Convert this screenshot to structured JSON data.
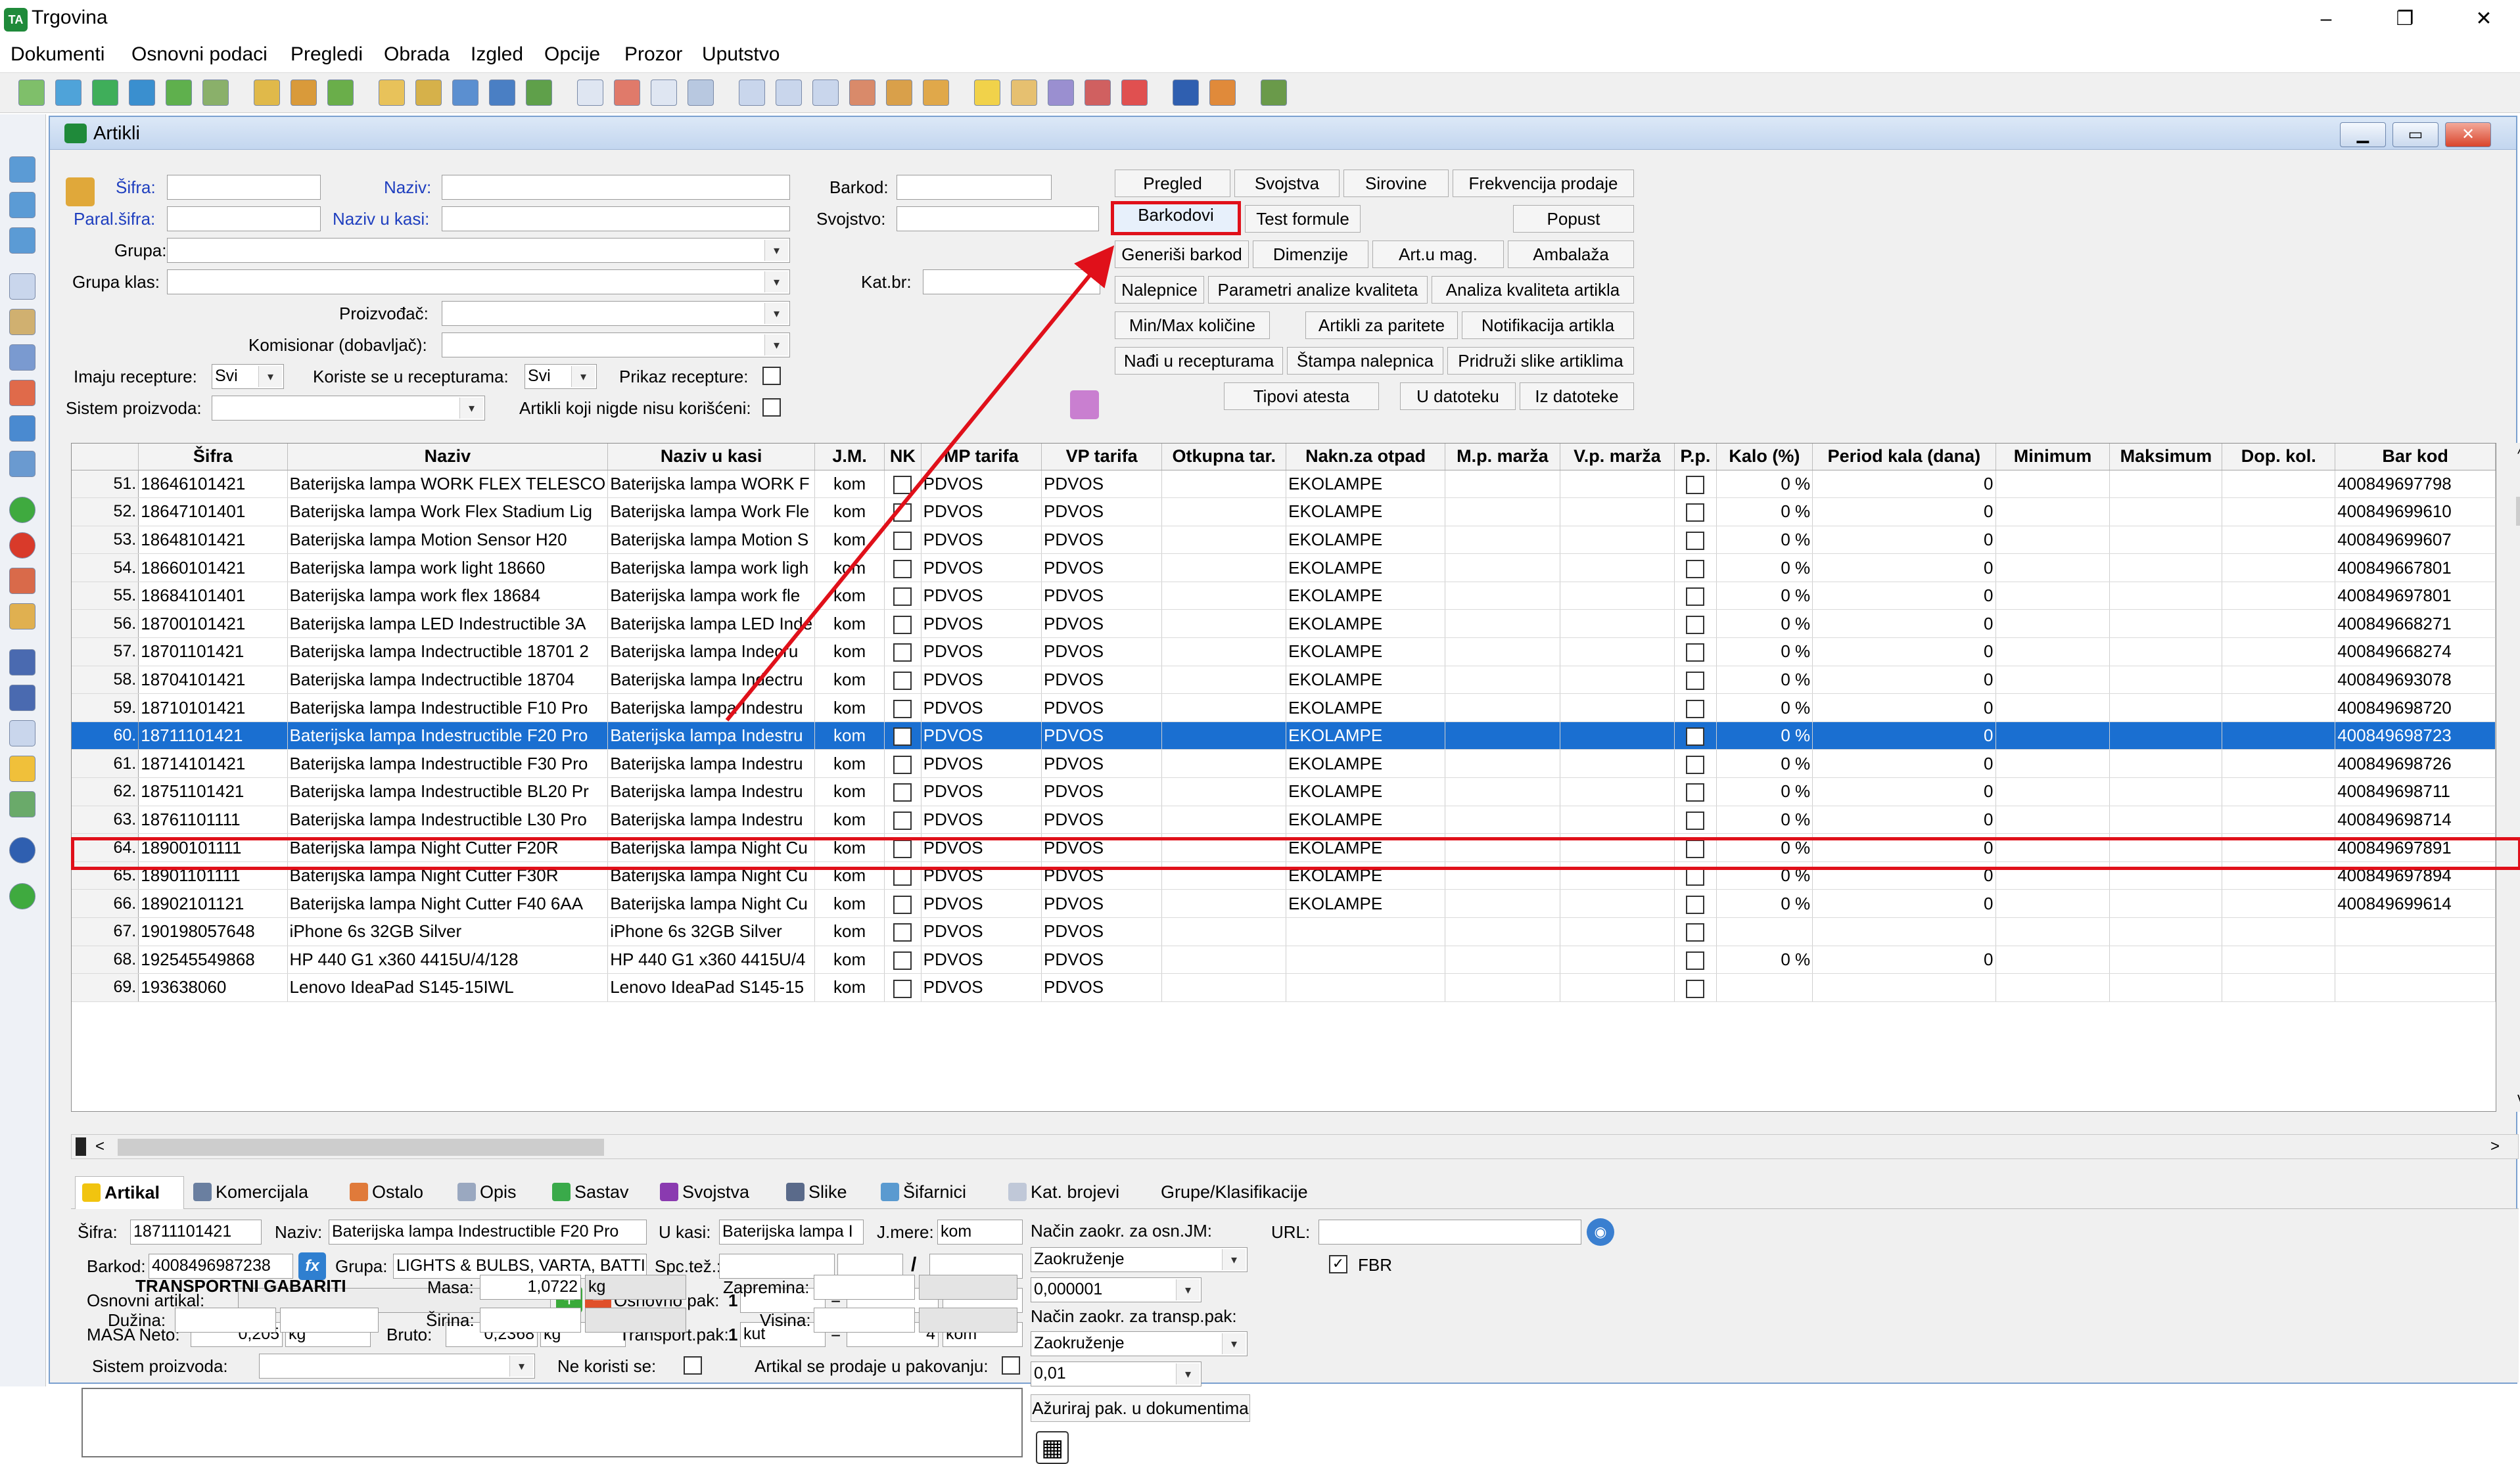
{
  "app": {
    "title": "Trgovina"
  },
  "menu": [
    "Dokumenti",
    "Osnovni podaci",
    "Pregledi",
    "Obrada",
    "Izgled",
    "Opcije",
    "Prozor",
    "Uputstvo"
  ],
  "window_controls": {
    "minimize": "–",
    "restore": "❐",
    "close": "✕"
  },
  "child": {
    "title": "Artikli",
    "minimize": "▁",
    "restore": "▭",
    "close": "✕"
  },
  "filters": {
    "sifra_label": "Šifra:",
    "naziv_label": "Naziv:",
    "paral_label": "Paral.šifra:",
    "naziv_kasa_label": "Naziv u kasi:",
    "grupa_label": "Grupa:",
    "grupa_klas_label": "Grupa klas:",
    "proizvodjac_label": "Proizvođač:",
    "komisionar_label": "Komisionar (dobavljač):",
    "imaju_label": "Imaju recepture:",
    "imaju_value": "Svi",
    "koriste_label": "Koriste se u recepturama:",
    "koriste_value": "Svi",
    "prikaz_label": "Prikaz recepture:",
    "sistem_label": "Sistem proizvoda:",
    "nigde_label": "Artikli koji nigde nisu korišćeni:",
    "barkod_label": "Barkod:",
    "svojstvo_label": "Svojstvo:",
    "katbr_label": "Kat.br:"
  },
  "buttons": {
    "pregled": "Pregled",
    "svojstva": "Svojstva",
    "sirovine": "Sirovine",
    "frekvencija": "Frekvencija prodaje",
    "barkodovi": "Barkodovi",
    "test_formule": "Test formule",
    "popust": "Popust",
    "generisi": "Generiši barkod",
    "dimenzije": "Dimenzije",
    "art_mag": "Art.u mag.",
    "ambalaza": "Ambalaža",
    "nalepnice": "Nalepnice",
    "parametri": "Parametri analize kvaliteta",
    "analiza": "Analiza kvaliteta artikla",
    "minmax": "Min/Max količine",
    "paritete": "Artikli za paritete",
    "notifikacija": "Notifikacija artikla",
    "nadji": "Nađi u recepturama",
    "stampa": "Štampa nalepnica",
    "pridruzi": "Pridruži slike artiklima",
    "tipovi": "Tipovi atesta",
    "u_datoteku": "U datoteku",
    "iz_datoteke": "Iz datoteke"
  },
  "grid": {
    "columns": [
      "",
      "Šifra",
      "Naziv",
      "Naziv u kasi",
      "J.M.",
      "NK",
      "MP tarifa",
      "VP tarifa",
      "Otkupna tar.",
      "Nakn.za otpad",
      "M.p. marža",
      "V.p. marža",
      "P.p.",
      "Kalo (%)",
      "Period kala (dana)",
      "Minimum",
      "Maksimum",
      "Dop. kol.",
      "Bar kod"
    ],
    "rows": [
      {
        "n": "51.",
        "sifra": "18646101421",
        "naziv": "Baterijska lampa WORK FLEX TELESCO",
        "kasa": "Baterijska lampa WORK F",
        "jm": "kom",
        "mp": "PDVOS",
        "vp": "PDVOS",
        "otpad": "EKOLAMPE",
        "kalo": "0 %",
        "period": "0",
        "bar": "400849697798"
      },
      {
        "n": "52.",
        "sifra": "18647101401",
        "naziv": "Baterijska lampa Work Flex Stadium Lig",
        "kasa": "Baterijska lampa Work Fle",
        "jm": "kom",
        "mp": "PDVOS",
        "vp": "PDVOS",
        "otpad": "EKOLAMPE",
        "kalo": "0 %",
        "period": "0",
        "bar": "400849699610"
      },
      {
        "n": "53.",
        "sifra": "18648101421",
        "naziv": "Baterijska lampa Motion Sensor H20",
        "kasa": "Baterijska lampa Motion S",
        "jm": "kom",
        "mp": "PDVOS",
        "vp": "PDVOS",
        "otpad": "EKOLAMPE",
        "kalo": "0 %",
        "period": "0",
        "bar": "400849699607"
      },
      {
        "n": "54.",
        "sifra": "18660101421",
        "naziv": "Baterijska lampa work light 18660",
        "kasa": "Baterijska lampa work ligh",
        "jm": "kom",
        "mp": "PDVOS",
        "vp": "PDVOS",
        "otpad": "EKOLAMPE",
        "kalo": "0 %",
        "period": "0",
        "bar": "400849667801"
      },
      {
        "n": "55.",
        "sifra": "18684101401",
        "naziv": "Baterijska lampa work flex 18684",
        "kasa": "Baterijska lampa work fle",
        "jm": "kom",
        "mp": "PDVOS",
        "vp": "PDVOS",
        "otpad": "EKOLAMPE",
        "kalo": "0 %",
        "period": "0",
        "bar": "400849697801"
      },
      {
        "n": "56.",
        "sifra": "18700101421",
        "naziv": "Baterijska lampa LED Indestructible 3A",
        "kasa": "Baterijska lampa LED Inde",
        "jm": "kom",
        "mp": "PDVOS",
        "vp": "PDVOS",
        "otpad": "EKOLAMPE",
        "kalo": "0 %",
        "period": "0",
        "bar": "400849668271"
      },
      {
        "n": "57.",
        "sifra": "18701101421",
        "naziv": "Baterijska lampa Indectructible 18701 2",
        "kasa": "Baterijska lampa Indecru",
        "jm": "kom",
        "mp": "PDVOS",
        "vp": "PDVOS",
        "otpad": "EKOLAMPE",
        "kalo": "0 %",
        "period": "0",
        "bar": "400849668274"
      },
      {
        "n": "58.",
        "sifra": "18704101421",
        "naziv": "Baterijska lampa Indectructible 18704",
        "kasa": "Baterijska lampa Indectru",
        "jm": "kom",
        "mp": "PDVOS",
        "vp": "PDVOS",
        "otpad": "EKOLAMPE",
        "kalo": "0 %",
        "period": "0",
        "bar": "400849693078"
      },
      {
        "n": "59.",
        "sifra": "18710101421",
        "naziv": "Baterijska lampa Indestructible F10 Pro",
        "kasa": "Baterijska lampa Indestru",
        "jm": "kom",
        "mp": "PDVOS",
        "vp": "PDVOS",
        "otpad": "EKOLAMPE",
        "kalo": "0 %",
        "period": "0",
        "bar": "400849698720"
      },
      {
        "n": "60.",
        "sifra": "18711101421",
        "naziv": "Baterijska lampa Indestructible F20 Pro",
        "kasa": "Baterijska lampa Indestru",
        "jm": "kom",
        "mp": "PDVOS",
        "vp": "PDVOS",
        "otpad": "EKOLAMPE",
        "kalo": "0 %",
        "period": "0",
        "bar": "400849698723"
      },
      {
        "n": "61.",
        "sifra": "18714101421",
        "naziv": "Baterijska lampa Indestructible F30 Pro",
        "kasa": "Baterijska lampa Indestru",
        "jm": "kom",
        "mp": "PDVOS",
        "vp": "PDVOS",
        "otpad": "EKOLAMPE",
        "kalo": "0 %",
        "period": "0",
        "bar": "400849698726"
      },
      {
        "n": "62.",
        "sifra": "18751101421",
        "naziv": "Baterijska lampa Indestructible BL20 Pr",
        "kasa": "Baterijska lampa Indestru",
        "jm": "kom",
        "mp": "PDVOS",
        "vp": "PDVOS",
        "otpad": "EKOLAMPE",
        "kalo": "0 %",
        "period": "0",
        "bar": "400849698711"
      },
      {
        "n": "63.",
        "sifra": "18761101111",
        "naziv": "Baterijska lampa Indestructible L30 Pro",
        "kasa": "Baterijska lampa Indestru",
        "jm": "kom",
        "mp": "PDVOS",
        "vp": "PDVOS",
        "otpad": "EKOLAMPE",
        "kalo": "0 %",
        "period": "0",
        "bar": "400849698714"
      },
      {
        "n": "64.",
        "sifra": "18900101111",
        "naziv": "Baterijska lampa Night Cutter F20R",
        "kasa": "Baterijska lampa Night Cu",
        "jm": "kom",
        "mp": "PDVOS",
        "vp": "PDVOS",
        "otpad": "EKOLAMPE",
        "kalo": "0 %",
        "period": "0",
        "bar": "400849697891"
      },
      {
        "n": "65.",
        "sifra": "18901101111",
        "naziv": "Baterijska lampa Night Cutter F30R",
        "kasa": "Baterijska lampa Night Cu",
        "jm": "kom",
        "mp": "PDVOS",
        "vp": "PDVOS",
        "otpad": "EKOLAMPE",
        "kalo": "0 %",
        "period": "0",
        "bar": "400849697894"
      },
      {
        "n": "66.",
        "sifra": "18902101121",
        "naziv": "Baterijska lampa Night Cutter F40 6AA",
        "kasa": "Baterijska lampa Night Cu",
        "jm": "kom",
        "mp": "PDVOS",
        "vp": "PDVOS",
        "otpad": "EKOLAMPE",
        "kalo": "0 %",
        "period": "0",
        "bar": "400849699614"
      },
      {
        "n": "67.",
        "sifra": "190198057648",
        "naziv": "iPhone 6s 32GB Silver",
        "kasa": "iPhone 6s 32GB Silver",
        "jm": "kom",
        "mp": "PDVOS",
        "vp": "PDVOS",
        "otpad": "",
        "kalo": "",
        "period": "",
        "bar": ""
      },
      {
        "n": "68.",
        "sifra": "192545549868",
        "naziv": "HP 440 G1 x360 4415U/4/128",
        "kasa": "HP 440 G1 x360 4415U/4",
        "jm": "kom",
        "mp": "PDVOS",
        "vp": "PDVOS",
        "otpad": "",
        "kalo": "0 %",
        "period": "0",
        "bar": ""
      },
      {
        "n": "69.",
        "sifra": "193638060",
        "naziv": "Lenovo IdeaPad S145-15IWL",
        "kasa": "Lenovo IdeaPad S145-15",
        "jm": "kom",
        "mp": "PDVOS",
        "vp": "PDVOS",
        "otpad": "",
        "kalo": "",
        "period": "",
        "bar": ""
      }
    ],
    "selected_index": 9
  },
  "tabs": [
    "Artikal",
    "Komercijala",
    "Ostalo",
    "Opis",
    "Sastav",
    "Svojstva",
    "Slike",
    "Šifarnici",
    "Kat. brojevi",
    "Grupe/Klasifikacije"
  ],
  "detail": {
    "sifra_label": "Šifra:",
    "sifra": "18711101421",
    "naziv_label": "Naziv:",
    "naziv": "Baterijska lampa Indestructible F20 Pro",
    "ukasi_label": "U kasi:",
    "ukasi": "Baterijska lampa I",
    "jmere_label": "J.mere:",
    "jmere": "kom",
    "zaokr_osn_label": "Način zaokr. za osn.JM:",
    "zaokr_osn": "Zaokruženje",
    "zaokr_osn_val": "0,000001",
    "zaokr_transp_label": "Način zaokr. za transp.pak:",
    "zaokr_transp": "Zaokruženje",
    "zaokr_transp_val": "0,01",
    "url_label": "URL:",
    "fbr_label": "FBR",
    "barkod_label": "Barkod:",
    "barkod": "4008496987238",
    "grupa_label": "Grupa:",
    "grupa": "LIGHTS & BULBS, VARTA, BATTI",
    "spctez_label": "Spc.tež.:",
    "slash": "/",
    "osnovni_art_label": "Osnovni artikal:",
    "osnovno_pak_label": "Osnovno pak:",
    "osnovno_pak_n": "1",
    "eq": "=",
    "masa_neto_label": "MASA Neto:",
    "masa_neto": "0,205",
    "masa_neto_unit": "kg",
    "bruto_label": "Bruto:",
    "bruto": "0,2368",
    "bruto_unit": "kg",
    "transport_label": "Transport.pak:",
    "transport_n": "1",
    "transport_unit": "kut",
    "transport_qty": "4",
    "transport_qty_unit": "kom",
    "sistem_label": "Sistem proizvoda:",
    "ne_koristi_label": "Ne koristi se:",
    "pakovanje_label": "Artikal se prodaje u pakovanju:",
    "gabariti_title": "TRANSPORTNI GABARITI",
    "masa_label": "Masa:",
    "masa": "1,0722",
    "masa_unit": "kg",
    "zapremina_label": "Zapremina:",
    "duzina_label": "Dužina:",
    "sirina_label": "Širina:",
    "visina_label": "Visina:",
    "azuriraj": "Ažuriraj pak. u dokumentima"
  },
  "icons": {
    "fx": "fx",
    "plus": "+",
    "minus": "−",
    "globe": "◉",
    "qr": "▦",
    "left": "<",
    "right": ">",
    "up": "^",
    "down": "v"
  }
}
